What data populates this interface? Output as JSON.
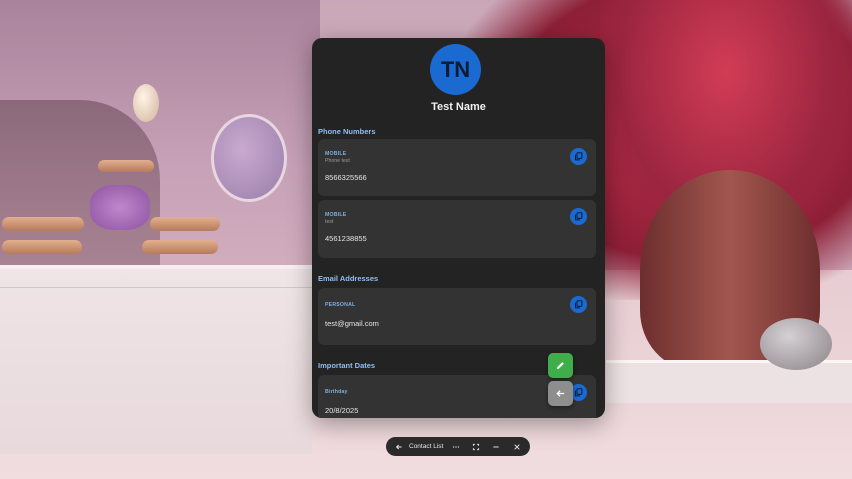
{
  "contact": {
    "initials": "TN",
    "name": "Test Name"
  },
  "sections": {
    "phones_title": "Phone Numbers",
    "emails_title": "Email Addresses",
    "dates_title": "Important Dates"
  },
  "phones": [
    {
      "type": "MOBILE",
      "label": "Phone test",
      "number": "8566325566"
    },
    {
      "type": "MOBILE",
      "label": "test",
      "number": "4561238855"
    }
  ],
  "emails": [
    {
      "type": "PERSONAL",
      "address": "test@gmail.com"
    }
  ],
  "dates": [
    {
      "label": "Birthday",
      "date": "20/8/2025"
    }
  ],
  "taskbar": {
    "title": "Contact List"
  },
  "icons": {
    "copy": "copy-icon",
    "edit": "pencil-icon",
    "back": "arrow-left-icon",
    "more": "more-horizontal-icon",
    "fullscreen": "fullscreen-icon",
    "minimize": "minimize-icon",
    "close": "close-icon"
  },
  "colors": {
    "accent": "#1b6ad2",
    "section_title": "#8fbef2",
    "edit_fab": "#3fae4a",
    "back_fab": "#8e8e8e",
    "window_bg": "#232323",
    "card_bg": "#333333"
  }
}
